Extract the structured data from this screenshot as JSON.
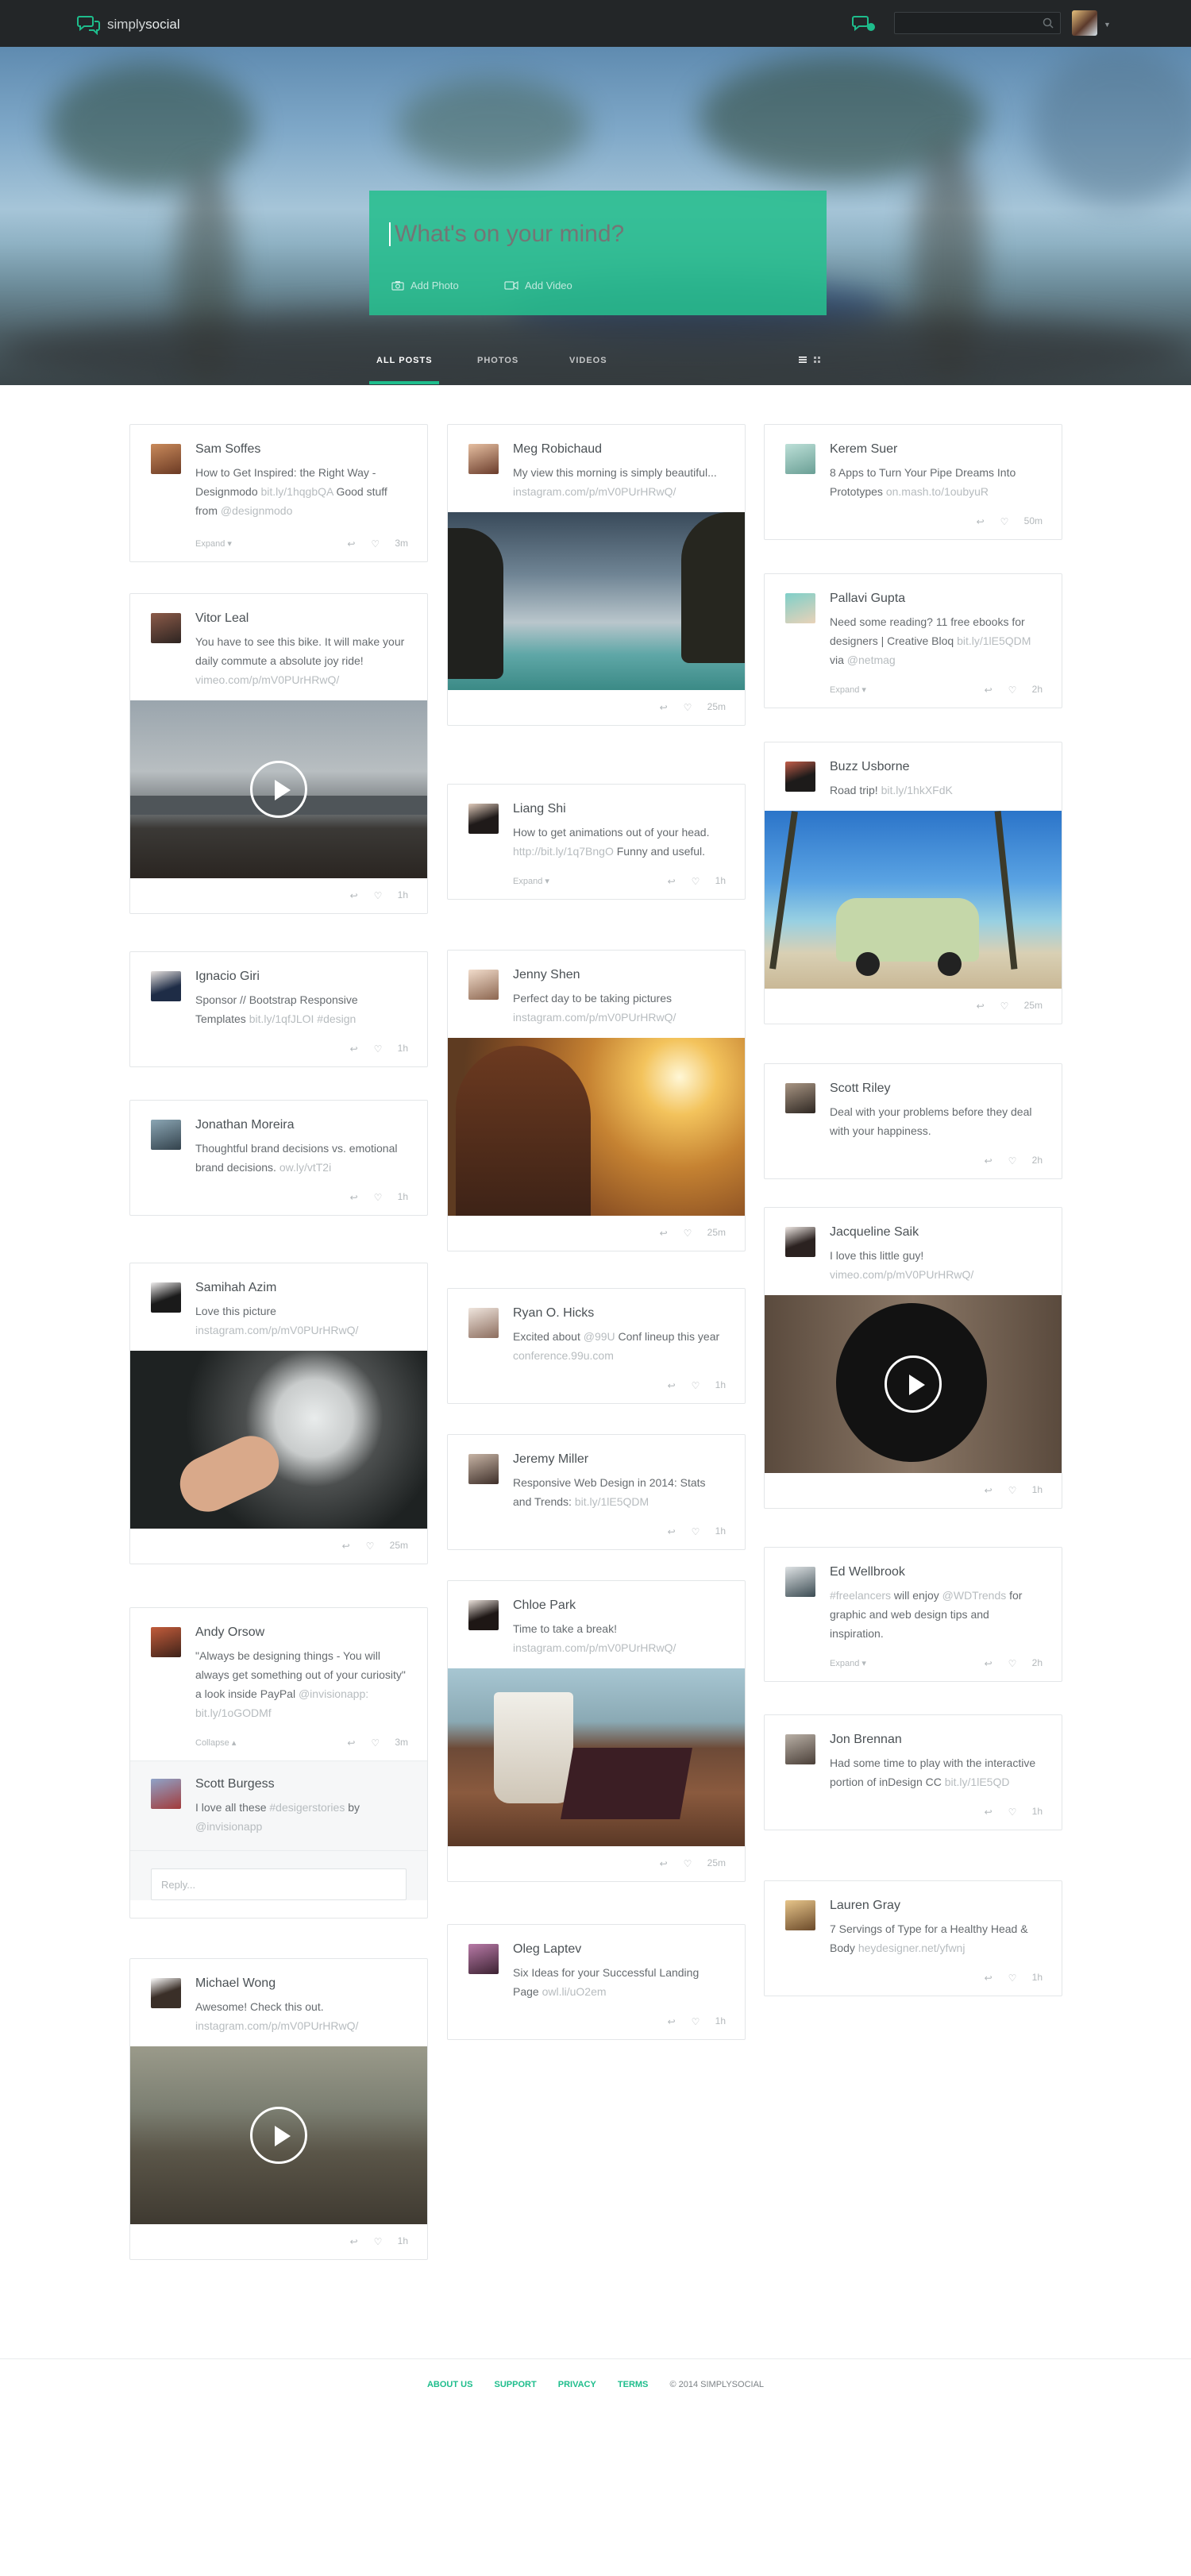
{
  "app": {
    "logo_light": "simply",
    "logo_bold": "social"
  },
  "search": {
    "placeholder": ""
  },
  "composer": {
    "placeholder": "What's on your mind?",
    "add_photo": "Add Photo",
    "add_video": "Add Video"
  },
  "tabs": [
    {
      "label": "ALL POSTS"
    },
    {
      "label": "PHOTOS"
    },
    {
      "label": "VIDEOS"
    }
  ],
  "colors": {
    "accent": "#1ebd8c",
    "topbar": "#232628"
  },
  "posts": {
    "c1": [
      {
        "name": "Sam Soffes",
        "text": "How to Get Inspired: the Right Way - Designmodo ",
        "link": "bit.ly/1hqgbQA",
        "text2": " Good stuff from ",
        "link2": "@designmodo",
        "expand": "Expand",
        "time": "3m"
      },
      {
        "name": "Vitor Leal",
        "text": "You have to see this bike. It will make your daily commute a absolute joy ride! ",
        "link": "vimeo.com/p/mV0PUrHRwQ/",
        "time": "1h"
      },
      {
        "name": "Ignacio Giri",
        "text": "Sponsor // Bootstrap Responsive Templates ",
        "link": "bit.ly/1qfJLOI #design",
        "time": "1h"
      },
      {
        "name": "Jonathan Moreira",
        "text": "Thoughtful brand decisions vs. emotional brand decisions. ",
        "link": "ow.ly/vtT2i",
        "time": "1h"
      },
      {
        "name": "Samihah Azim",
        "text": "Love this picture ",
        "link": "instagram.com/p/mV0PUrHRwQ/",
        "time": "25m"
      },
      {
        "name": "Andy Orsow",
        "text": "\"Always be designing things - You will always get something out of your curiosity\" a look inside PayPal ",
        "link": "@invisionapp: bit.ly/1oGODMf",
        "expand": "Collapse",
        "time": "3m"
      },
      {
        "name": "Scott Burgess",
        "text": "I love all these ",
        "link": "#desigerstories",
        "text2": " by ",
        "link2": "@invisionapp",
        "reply_placeholder": "Reply..."
      },
      {
        "name": "Michael Wong",
        "text": "Awesome! Check this out. ",
        "link": "instagram.com/p/mV0PUrHRwQ/",
        "time": "1h"
      }
    ],
    "c2": [
      {
        "name": "Meg Robichaud",
        "text": "My view this morning is simply beautiful... ",
        "link": "instagram.com/p/mV0PUrHRwQ/",
        "time": "25m"
      },
      {
        "name": "Liang Shi",
        "text": "How to get animations out of your head. ",
        "link": "http://bit.ly/1q7BngO",
        "text2": " Funny and useful.",
        "expand": "Expand",
        "time": "1h"
      },
      {
        "name": "Jenny Shen",
        "text": "Perfect day to be taking pictures ",
        "link": "instagram.com/p/mV0PUrHRwQ/",
        "time": "25m"
      },
      {
        "name": "Ryan O. Hicks",
        "text": "Excited about ",
        "link": "@99U",
        "text2": " Conf lineup this year ",
        "link2": "conference.99u.com",
        "time": "1h"
      },
      {
        "name": "Jeremy Miller",
        "text": "Responsive Web Design in 2014: Stats and Trends: ",
        "link": "bit.ly/1lE5QDM",
        "time": "1h"
      },
      {
        "name": "Chloe Park",
        "text": "Time to take a break! ",
        "link": "instagram.com/p/mV0PUrHRwQ/",
        "time": "25m"
      },
      {
        "name": "Oleg Laptev",
        "text": "Six Ideas for your Successful Landing Page ",
        "link": "owl.li/uO2em",
        "time": "1h"
      }
    ],
    "c3": [
      {
        "name": "Kerem Suer",
        "text": "8 Apps to Turn Your Pipe Dreams Into Prototypes ",
        "link": "on.mash.to/1oubyuR",
        "time": "50m"
      },
      {
        "name": "Pallavi Gupta",
        "text": "Need some reading? 11 free ebooks for designers | Creative Bloq ",
        "link": "bit.ly/1lE5QDM",
        "text2": " via ",
        "link2": "@netmag",
        "expand": "Expand",
        "time": "2h"
      },
      {
        "name": "Buzz Usborne",
        "text": "Road trip! ",
        "link": "bit.ly/1hkXFdK",
        "time": "25m"
      },
      {
        "name": "Scott Riley",
        "text": "Deal with your problems before they deal with your happiness.",
        "time": "2h"
      },
      {
        "name": "Jacqueline Saik",
        "text": "I love this little guy! ",
        "link": "vimeo.com/p/mV0PUrHRwQ/",
        "time": "1h"
      },
      {
        "name": "Ed Wellbrook",
        "text": "",
        "link": "#freelancers",
        "text2": " will enjoy ",
        "link2": "@WDTrends",
        "text3": " for graphic and web design tips and inspiration.",
        "expand": "Expand",
        "time": "2h"
      },
      {
        "name": "Jon Brennan",
        "text": "Had some time to play with the interactive portion of inDesign CC ",
        "link": "bit.ly/1lE5QD",
        "time": "1h"
      },
      {
        "name": "Lauren Gray",
        "text": "7 Servings of Type for a Healthy Head & Body ",
        "link": "heydesigner.net/yfwnj",
        "time": "1h"
      }
    ]
  },
  "footer": {
    "about": "ABOUT US",
    "support": "SUPPORT",
    "privacy": "PRIVACY",
    "terms": "TERMS",
    "copyright": "© 2014 SIMPLYSOCIAL"
  }
}
